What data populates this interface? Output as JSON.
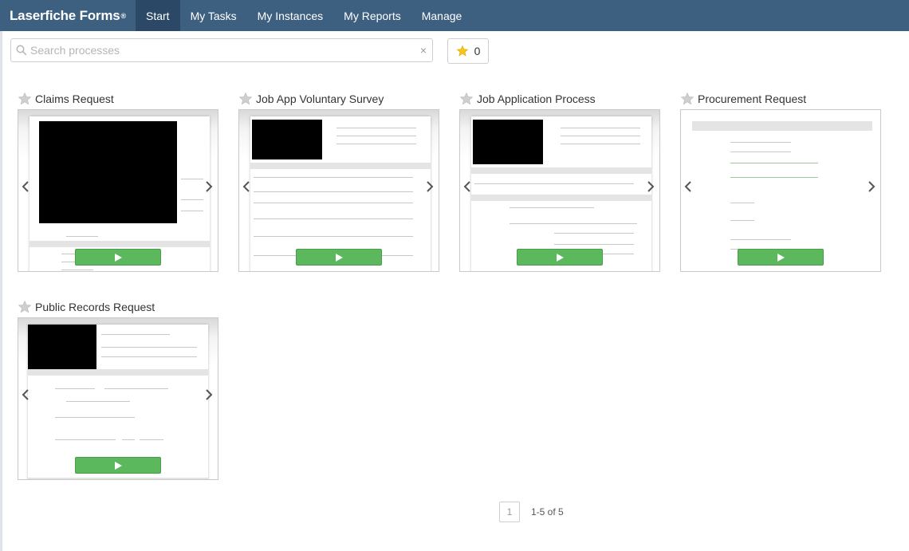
{
  "brand": {
    "name": "Laserfiche Forms",
    "mark": "®"
  },
  "nav": [
    {
      "label": "Start",
      "active": true
    },
    {
      "label": "My Tasks",
      "active": false
    },
    {
      "label": "My Instances",
      "active": false
    },
    {
      "label": "My Reports",
      "active": false
    },
    {
      "label": "Manage",
      "active": false
    }
  ],
  "search": {
    "placeholder": "Search processes",
    "value": "",
    "clear": "×"
  },
  "favorites": {
    "count": "0"
  },
  "cards": [
    {
      "title": "Claims Request"
    },
    {
      "title": "Job App Voluntary Survey"
    },
    {
      "title": "Job Application Process"
    },
    {
      "title": "Procurement Request"
    },
    {
      "title": "Public Records Request"
    }
  ],
  "pagination": {
    "current": "1",
    "range": "1-5 of 5"
  },
  "colors": {
    "nav_bg": "#3e6080",
    "nav_active": "#2b4966",
    "play_green": "#5cb85c",
    "star_gold": "#f5c518"
  }
}
